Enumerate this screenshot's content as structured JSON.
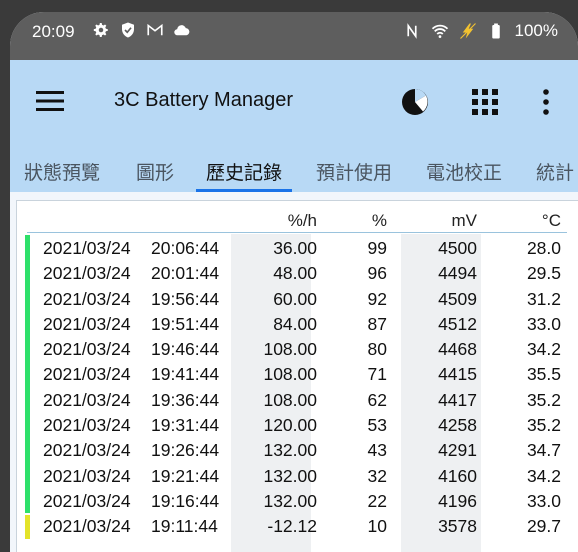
{
  "status_bar": {
    "time": "20:09",
    "battery_percent": "100%",
    "icons": [
      "gear-icon",
      "shield-icon",
      "gmail-icon",
      "cloud-icon",
      "nfc-icon",
      "wifi-icon",
      "charging-bolt-icon",
      "battery-icon"
    ]
  },
  "app_bar": {
    "title": "3C Battery Manager",
    "icons": [
      "menu-icon",
      "pie-chart-icon",
      "grid-icon",
      "more-vert-icon"
    ]
  },
  "tabs": [
    {
      "label": "狀態預覽",
      "active": false
    },
    {
      "label": "圖形",
      "active": false
    },
    {
      "label": "歷史記錄",
      "active": true
    },
    {
      "label": "預計使用",
      "active": false
    },
    {
      "label": "電池校正",
      "active": false
    },
    {
      "label": "統計",
      "active": false
    }
  ],
  "history": {
    "columns": [
      "%/h",
      "%",
      "mV",
      "°C"
    ],
    "rows": [
      {
        "date": "2021/03/24",
        "time": "20:06:44",
        "rate": "36.00",
        "pct": "99",
        "mv": "4500",
        "temp": "28.0",
        "state": "charging"
      },
      {
        "date": "2021/03/24",
        "time": "20:01:44",
        "rate": "48.00",
        "pct": "96",
        "mv": "4494",
        "temp": "29.5",
        "state": "charging"
      },
      {
        "date": "2021/03/24",
        "time": "19:56:44",
        "rate": "60.00",
        "pct": "92",
        "mv": "4509",
        "temp": "31.2",
        "state": "charging"
      },
      {
        "date": "2021/03/24",
        "time": "19:51:44",
        "rate": "84.00",
        "pct": "87",
        "mv": "4512",
        "temp": "33.0",
        "state": "charging"
      },
      {
        "date": "2021/03/24",
        "time": "19:46:44",
        "rate": "108.00",
        "pct": "80",
        "mv": "4468",
        "temp": "34.2",
        "state": "charging"
      },
      {
        "date": "2021/03/24",
        "time": "19:41:44",
        "rate": "108.00",
        "pct": "71",
        "mv": "4415",
        "temp": "35.5",
        "state": "charging"
      },
      {
        "date": "2021/03/24",
        "time": "19:36:44",
        "rate": "108.00",
        "pct": "62",
        "mv": "4417",
        "temp": "35.2",
        "state": "charging"
      },
      {
        "date": "2021/03/24",
        "time": "19:31:44",
        "rate": "120.00",
        "pct": "53",
        "mv": "4258",
        "temp": "35.2",
        "state": "charging"
      },
      {
        "date": "2021/03/24",
        "time": "19:26:44",
        "rate": "132.00",
        "pct": "43",
        "mv": "4291",
        "temp": "34.7",
        "state": "charging"
      },
      {
        "date": "2021/03/24",
        "time": "19:21:44",
        "rate": "132.00",
        "pct": "32",
        "mv": "4160",
        "temp": "34.2",
        "state": "charging"
      },
      {
        "date": "2021/03/24",
        "time": "19:16:44",
        "rate": "132.00",
        "pct": "22",
        "mv": "4196",
        "temp": "33.0",
        "state": "charging"
      },
      {
        "date": "2021/03/24",
        "time": "19:11:44",
        "rate": "-12.12",
        "pct": "10",
        "mv": "3578",
        "temp": "29.7",
        "state": "discharging"
      }
    ]
  },
  "colors": {
    "status_bar": "#5e5e5e",
    "app_bar": "#b8d9f5",
    "tab_indicator": "#1a73e8",
    "charging_bar": "#2ee06a",
    "discharging_bar": "#e3e32a",
    "column_shade": "#eef0f2"
  }
}
